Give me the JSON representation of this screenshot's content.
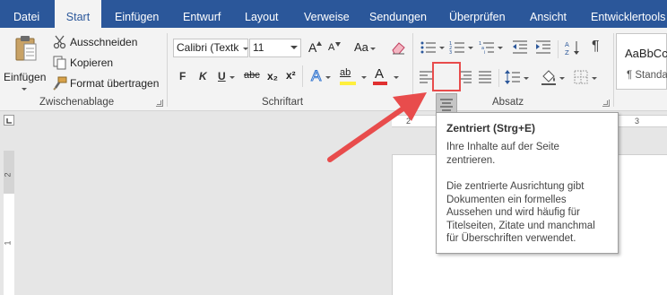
{
  "tabs": [
    {
      "label": "Datei"
    },
    {
      "label": "Start"
    },
    {
      "label": "Einfügen"
    },
    {
      "label": "Entwurf"
    },
    {
      "label": "Layout"
    },
    {
      "label": "Verweise"
    },
    {
      "label": "Sendungen"
    },
    {
      "label": "Überprüfen"
    },
    {
      "label": "Ansicht"
    },
    {
      "label": "Entwicklertools"
    }
  ],
  "clipboard": {
    "paste_label": "Einfügen",
    "cut_label": "Ausschneiden",
    "copy_label": "Kopieren",
    "format_painter_label": "Format übertragen",
    "group_label": "Zwischenablage"
  },
  "font": {
    "font_name": "Calibri (Textk",
    "font_size": "11",
    "grow_label": "A",
    "shrink_label": "A",
    "case_label": "Aa",
    "bold_label": "F",
    "italic_label": "K",
    "underline_label": "U",
    "strike_label": "abc",
    "subscript_label": "x₂",
    "superscript_label": "x²",
    "effects_label": "A",
    "highlight_label": "ab",
    "color_label": "A",
    "group_label": "Schriftart",
    "accent_color": "#e03030",
    "highlight_color": "#ffef3d"
  },
  "paragraph": {
    "pilcrow_label": "¶",
    "group_label": "Absatz"
  },
  "styles": {
    "sample_label": "AaBbCc",
    "standard_label": "¶ Standa"
  },
  "ruler": {
    "h_marks": [
      "2",
      "3"
    ],
    "v_marks": [
      "2",
      "1"
    ]
  },
  "tooltip": {
    "title": "Zentriert (Strg+E)",
    "paragraph1": "Ihre Inhalte auf der Seite zentrieren.",
    "paragraph2": "Die zentrierte Ausrichtung gibt Dokumenten ein formelles Aussehen und wird häufig für Titelseiten, Zitate und manchmal für Überschriften verwendet."
  },
  "colors": {
    "tab_bar": "#2b579a",
    "ribbon": "#f3f3f3",
    "callout_red": "#e84c4c"
  }
}
